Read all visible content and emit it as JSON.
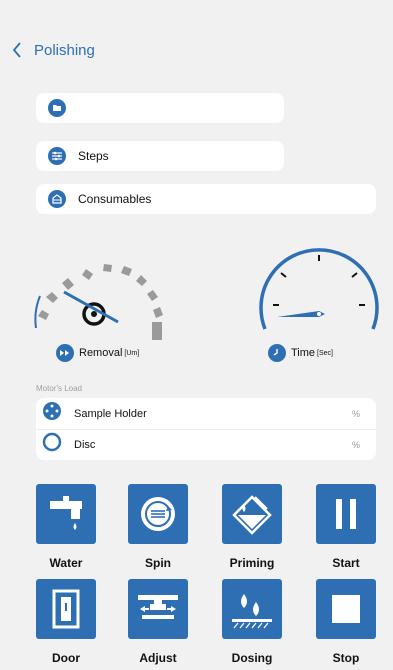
{
  "header": {
    "title": "Polishing"
  },
  "fields": [
    {
      "label": "",
      "icon": "folder-icon"
    },
    {
      "label": "Steps",
      "icon": "sliders-icon"
    },
    {
      "label": "Consumables",
      "icon": "box-icon"
    }
  ],
  "gauges": {
    "removal": {
      "label": "Removal",
      "unit": "[Um]",
      "icon": "fast-forward-icon"
    },
    "time": {
      "label": "Time",
      "unit": "[Sec]",
      "icon": "clock-icon"
    }
  },
  "motor_load": {
    "title": "Motor's Load",
    "rows": [
      {
        "label": "Sample Holder",
        "unit": "%",
        "icon": "sample-holder-icon"
      },
      {
        "label": "Disc",
        "unit": "%",
        "icon": "disc-icon"
      }
    ]
  },
  "buttons": [
    {
      "label": "Water",
      "icon": "water-tap-icon"
    },
    {
      "label": "Spin",
      "icon": "spin-icon"
    },
    {
      "label": "Priming",
      "icon": "priming-icon"
    },
    {
      "label": "Start",
      "icon": "pause-icon"
    },
    {
      "label": "Door",
      "icon": "door-icon"
    },
    {
      "label": "Adjust",
      "icon": "adjust-icon"
    },
    {
      "label": "Dosing",
      "icon": "dosing-icon"
    },
    {
      "label": "Stop",
      "icon": "stop-icon"
    }
  ],
  "colors": {
    "accent": "#2e6fb3",
    "background": "#f1f1f1",
    "gauge_gray": "#9a9a9a"
  }
}
